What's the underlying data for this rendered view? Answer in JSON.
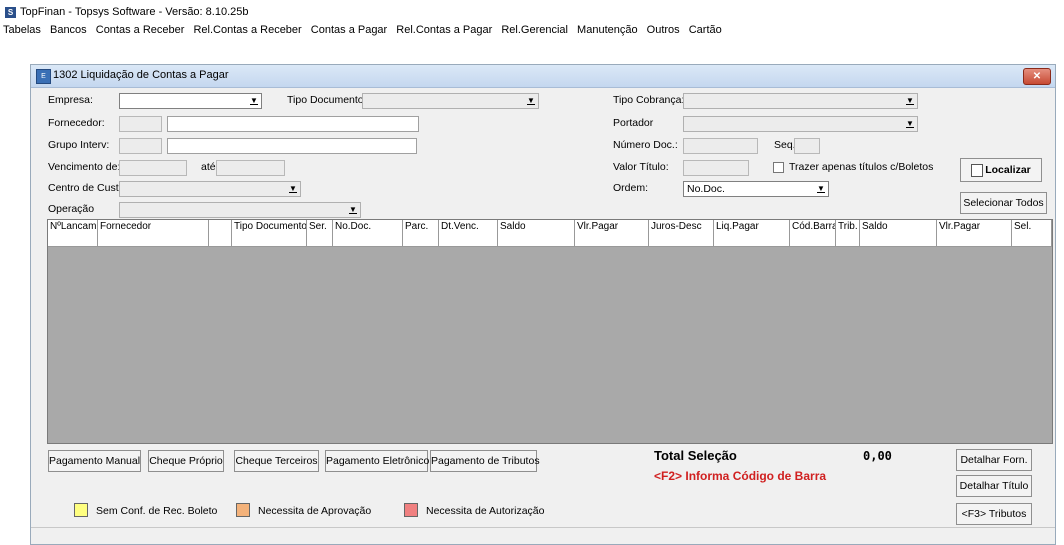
{
  "app": {
    "title": "TopFinan - Topsys Software - Versão: 8.10.25b",
    "icon": "app-icon"
  },
  "menu": [
    "Tabelas",
    "Bancos",
    "Contas a Receber",
    "Rel.Contas a Receber",
    "Contas a Pagar",
    "Rel.Contas a Pagar",
    "Rel.Gerencial",
    "Manutenção",
    "Outros",
    "Cartão"
  ],
  "window": {
    "title": "1302 Liquidação de Contas a Pagar",
    "close": "✕"
  },
  "form": {
    "empresa_label": "Empresa:",
    "tipo_documento_label": "Tipo Documento",
    "fornecedor_label": "Fornecedor:",
    "grupo_interv_label": "Grupo Interv:",
    "vencimento_label": "Vencimento de:",
    "ate_label": "até",
    "centro_custo_label": "Centro de Custo:",
    "operacao_label": "Operação",
    "tipo_cobranca_label": "Tipo Cobrança:",
    "portador_label": "Portador",
    "numero_doc_label": "Número Doc.:",
    "seq_label": "Seq.",
    "valor_titulo_label": "Valor Título:",
    "trazer_label": "Trazer apenas títulos c/Boletos",
    "ordem_label": "Ordem:",
    "ordem_value": "No.Doc."
  },
  "buttons": {
    "localizar": "Localizar",
    "selecionar_todos": "Selecionar Todos",
    "pagamento_manual": "Pagamento Manual",
    "cheque_proprio": "Cheque Próprio",
    "cheque_terceiros": "Cheque Terceiros",
    "pagamento_eletronico": "Pagamento Eletrônico",
    "pagamento_tributos": "Pagamento de Tributos",
    "detalhar_forn": "Detalhar Forn.",
    "detalhar_titulo": "Detalhar Título",
    "f3_tributos": "<F3> Tributos"
  },
  "grid": {
    "columns": [
      "NºLancam",
      "Fornecedor",
      "",
      "Tipo Documento",
      "Ser.",
      "No.Doc.",
      "Parc.",
      "Dt.Venc.",
      "Saldo",
      "Vlr.Pagar",
      "Juros-Desc",
      "Liq.Pagar",
      "Cód.Barra",
      "Trib.",
      "Saldo",
      "Vlr.Pagar",
      "Sel."
    ]
  },
  "totals": {
    "label": "Total Seleção",
    "value": "0,00",
    "f2_hint": "<F2> Informa Código de Barra"
  },
  "legend": [
    {
      "label": "Sem Conf. de Rec. Boleto",
      "color": "#ffff80"
    },
    {
      "label": "Necessita de Aprovação",
      "color": "#f4b27a"
    },
    {
      "label": "Necessita de Autorização",
      "color": "#f08080"
    }
  ],
  "colors": {
    "hint_red": "#d02020",
    "grid_bg": "#a9a9a9"
  }
}
